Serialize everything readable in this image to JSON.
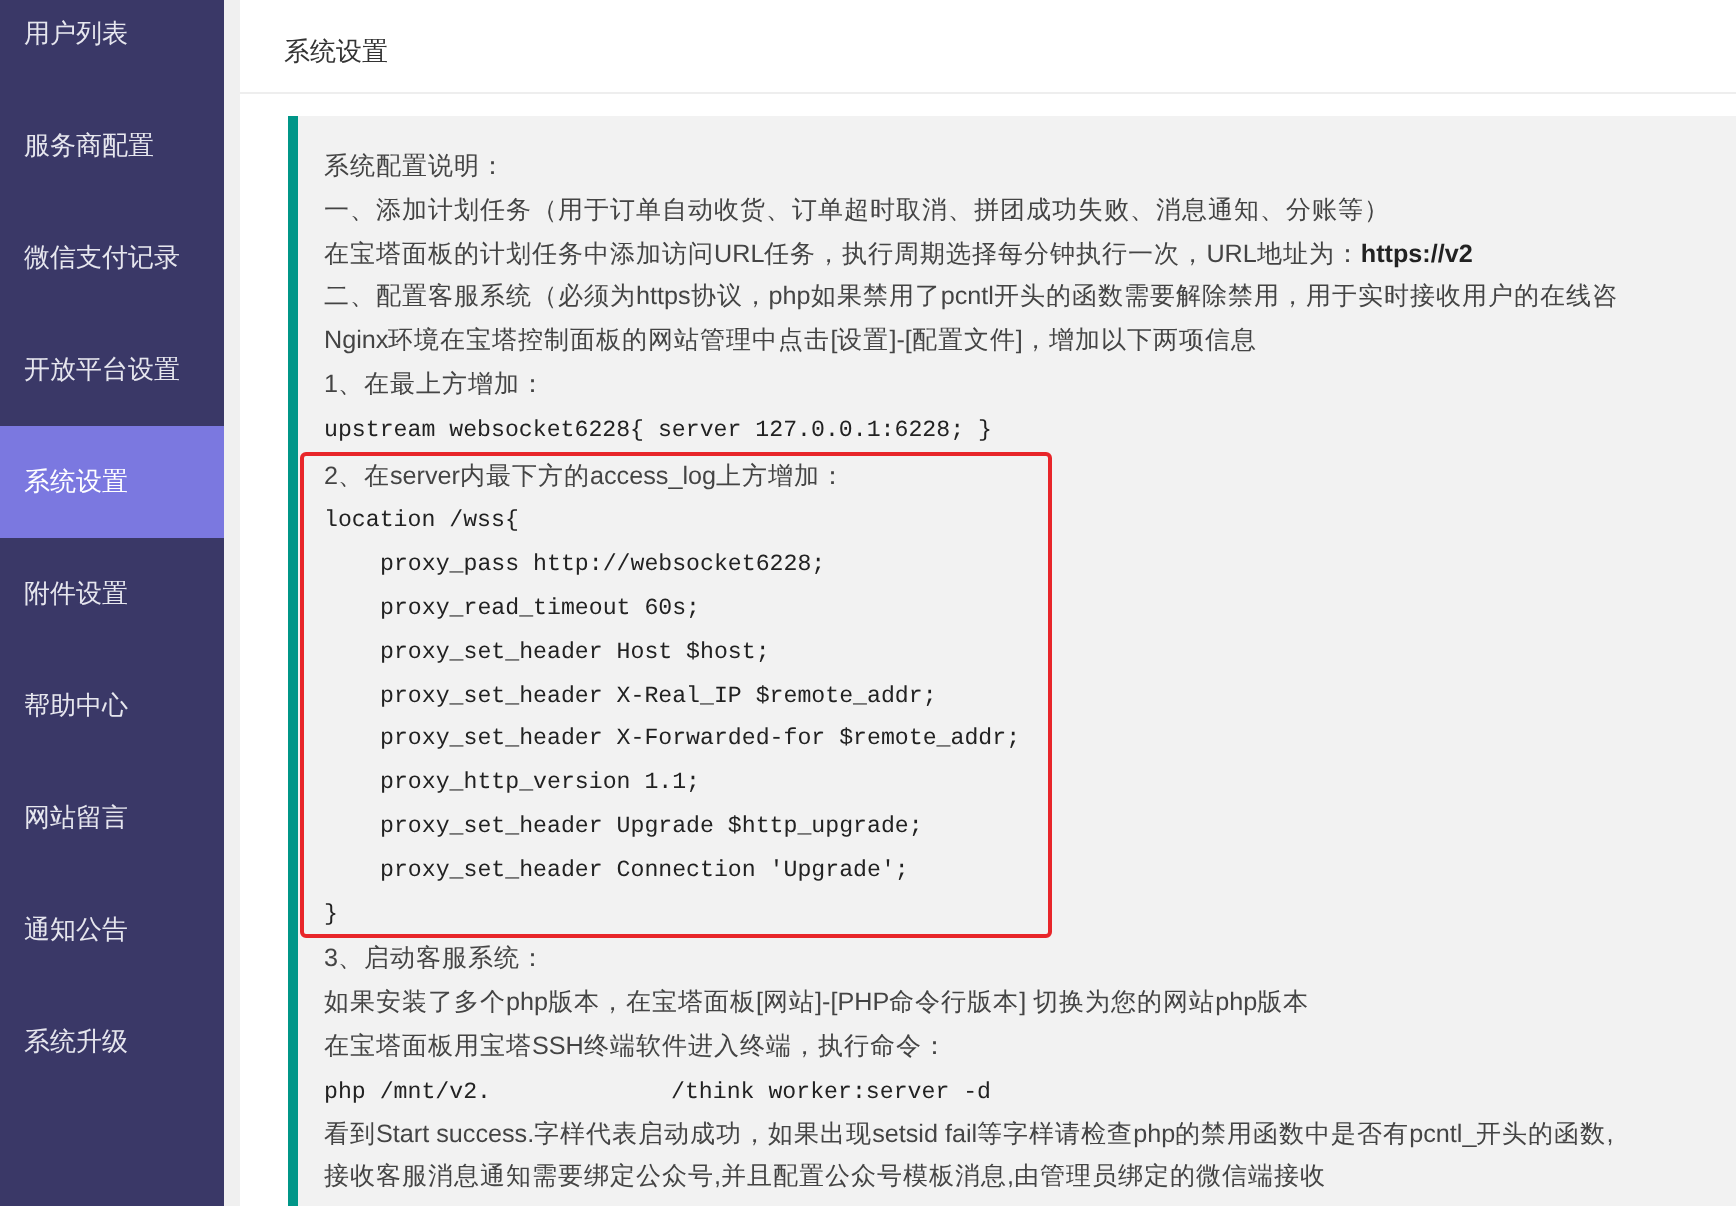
{
  "sidebar": {
    "items": [
      {
        "label": "用户列表",
        "selected": false
      },
      {
        "label": "服务商配置",
        "selected": false
      },
      {
        "label": "微信支付记录",
        "selected": false
      },
      {
        "label": "开放平台设置",
        "selected": false
      },
      {
        "label": "系统设置",
        "selected": true
      },
      {
        "label": "附件设置",
        "selected": false
      },
      {
        "label": "帮助中心",
        "selected": false
      },
      {
        "label": "网站留言",
        "selected": false
      },
      {
        "label": "通知公告",
        "selected": false
      },
      {
        "label": "系统升级",
        "selected": false
      }
    ]
  },
  "page": {
    "title": "系统设置"
  },
  "notes": {
    "before": [
      {
        "kind": "text",
        "text": "系统配置说明："
      },
      {
        "kind": "text",
        "text": "一、添加计划任务（用于订单自动收货、订单超时取消、拼团成功失败、消息通知、分账等）"
      },
      {
        "kind": "text",
        "text": "在宝塔面板的计划任务中添加访问URL任务，执行周期选择每分钟执行一次，URL地址为：**https://v2**"
      },
      {
        "kind": "text",
        "text": "二、配置客服系统（必须为https协议，php如果禁用了pcntl开头的函数需要解除禁用，用于实时接收用户的在线咨"
      },
      {
        "kind": "text",
        "text": "Nginx环境在宝塔控制面板的网站管理中点击[设置]-[配置文件]，增加以下两项信息"
      },
      {
        "kind": "text",
        "text": "1、在最上方增加："
      },
      {
        "kind": "code",
        "text": "upstream websocket6228{ server 127.0.0.1:6228; }"
      }
    ],
    "highlighted": [
      {
        "kind": "text",
        "text": "2、在server内最下方的access_log上方增加："
      },
      {
        "kind": "code",
        "text": "location /wss{",
        "children": [
          {
            "kind": "code",
            "text": "proxy_pass http://websocket6228;"
          },
          {
            "kind": "code",
            "text": "proxy_read_timeout 60s;"
          },
          {
            "kind": "code",
            "text": "proxy_set_header Host $host;"
          },
          {
            "kind": "code",
            "text": "proxy_set_header X-Real_IP $remote_addr;"
          },
          {
            "kind": "code",
            "text": "proxy_set_header X-Forwarded-for $remote_addr;"
          },
          {
            "kind": "code",
            "text": "proxy_http_version 1.1;"
          },
          {
            "kind": "code",
            "text": "proxy_set_header Upgrade $http_upgrade;"
          },
          {
            "kind": "code",
            "text": "proxy_set_header Connection 'Upgrade';"
          }
        ]
      },
      {
        "kind": "code",
        "text": "}"
      }
    ],
    "after": [
      {
        "kind": "text",
        "text": "3、启动客服系统："
      },
      {
        "kind": "text",
        "text": "如果安装了多个php版本，在宝塔面板[网站]-[PHP命令行版本] 切换为您的网站php版本"
      },
      {
        "kind": "text",
        "text": "在宝塔面板用宝塔SSH终端软件进入终端，执行命令："
      },
      {
        "kind": "code",
        "text": "php /mnt/v2.",
        "text_2": "/think worker:server -d"
      },
      {
        "kind": "text",
        "text": "看到Start success.字样代表启动成功，如果出现setsid fail等字样请检查php的禁用函数中是否有pcntl_开头的函数,"
      },
      {
        "kind": "text",
        "text": "接收客服消息通知需要绑定公众号,并且配置公众号模板消息,由管理员绑定的微信端接收"
      }
    ]
  }
}
